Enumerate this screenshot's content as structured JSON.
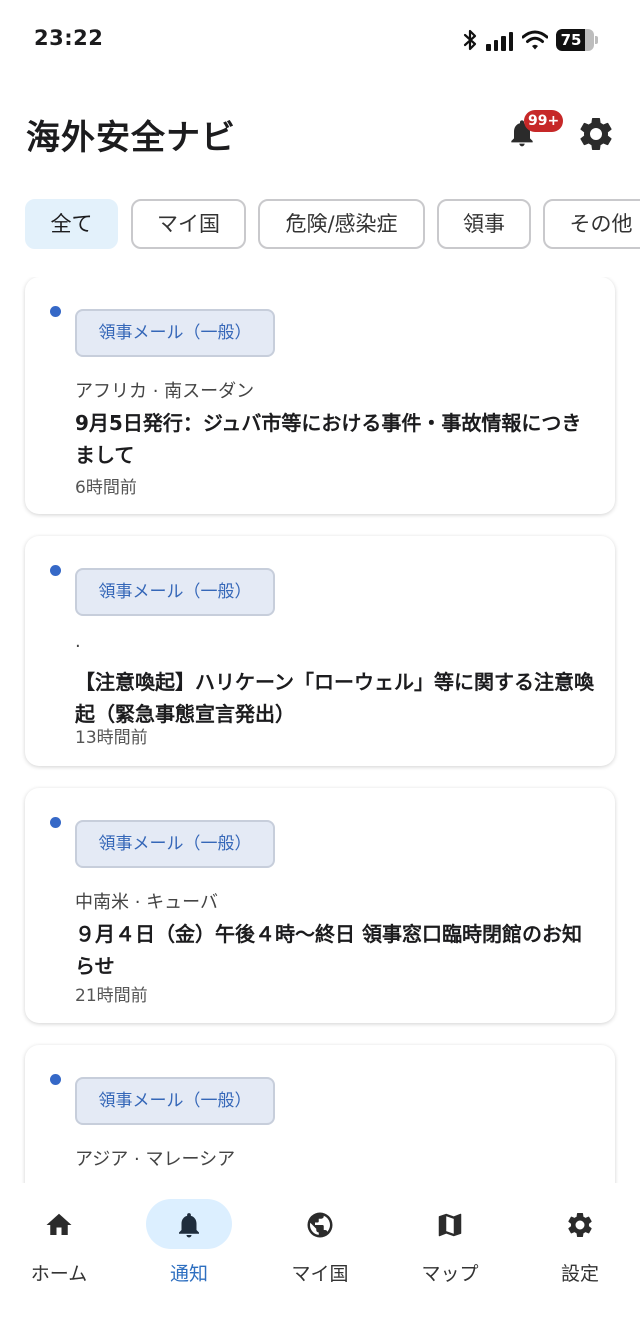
{
  "status_bar": {
    "time": "23:22",
    "battery": "75",
    "battery_level": 0.75
  },
  "header": {
    "title": "海外安全ナビ",
    "notification_badge": "99+"
  },
  "filters": [
    {
      "label": "全て",
      "active": true
    },
    {
      "label": "マイ国",
      "active": false
    },
    {
      "label": "危険/感染症",
      "active": false
    },
    {
      "label": "領事",
      "active": false
    },
    {
      "label": "その他",
      "active": false
    }
  ],
  "notifications": [
    {
      "tag": "領事メール（一般）",
      "region": "アフリカ · 南スーダン",
      "title": "9月5日発行：ジュバ市等における事件・事故情報につきまして",
      "time": "6時間前",
      "unread": true
    },
    {
      "tag": "領事メール（一般）",
      "region": "·",
      "title": "【注意喚起】ハリケーン「ローウェル」等に関する注意喚起（緊急事態宣言発出）",
      "time": "13時間前",
      "unread": true
    },
    {
      "tag": "領事メール（一般）",
      "region": "中南米 · キューバ",
      "title": "９月４日（金）午後４時～終日 領事窓口臨時閉館のお知らせ",
      "time": "21時間前",
      "unread": true
    },
    {
      "tag": "領事メール（一般）",
      "region": "アジア · マレーシア",
      "title": "",
      "time": "",
      "unread": true
    }
  ],
  "tabs": [
    {
      "label": "ホーム",
      "icon": "home-icon",
      "active": false
    },
    {
      "label": "通知",
      "icon": "bell-icon",
      "active": true
    },
    {
      "label": "マイ国",
      "icon": "globe-icon",
      "active": false
    },
    {
      "label": "マップ",
      "icon": "map-icon",
      "active": false
    },
    {
      "label": "設定",
      "icon": "gear-icon",
      "active": false
    }
  ],
  "colors": {
    "accent": "#2e6fc0",
    "unread_dot": "#3568c7",
    "badge": "#c62828",
    "chip_active_bg": "#e3f1fb",
    "tag_bg": "#e4eaf5"
  }
}
